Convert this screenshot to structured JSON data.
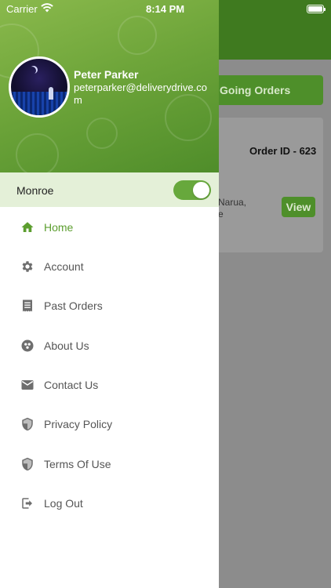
{
  "status_bar": {
    "carrier": "Carrier",
    "time": "8:14 PM"
  },
  "background": {
    "tab_label": "Going Orders",
    "order_id": "Order ID - 623",
    "address_line1": "Narua,",
    "address_line2": "e",
    "view_label": "View"
  },
  "drawer": {
    "user": {
      "name": "Peter Parker",
      "email": "peterparker@deliverydrive.com"
    },
    "location": {
      "label": "Monroe",
      "toggle_on": true
    },
    "menu": [
      {
        "label": "Home",
        "icon": "home-icon",
        "active": true
      },
      {
        "label": "Account",
        "icon": "gear-icon",
        "active": false
      },
      {
        "label": "Past Orders",
        "icon": "receipt-icon",
        "active": false
      },
      {
        "label": "About Us",
        "icon": "group-icon",
        "active": false
      },
      {
        "label": "Contact Us",
        "icon": "mail-icon",
        "active": false
      },
      {
        "label": "Privacy Policy",
        "icon": "shield-icon",
        "active": false
      },
      {
        "label": "Terms Of Use",
        "icon": "shield-icon",
        "active": false
      },
      {
        "label": "Log Out",
        "icon": "logout-icon",
        "active": false
      }
    ]
  },
  "colors": {
    "brand_green": "#5c9e2f",
    "icon_gray": "#6e6e6e",
    "header_dark": "#3f7a1f"
  }
}
